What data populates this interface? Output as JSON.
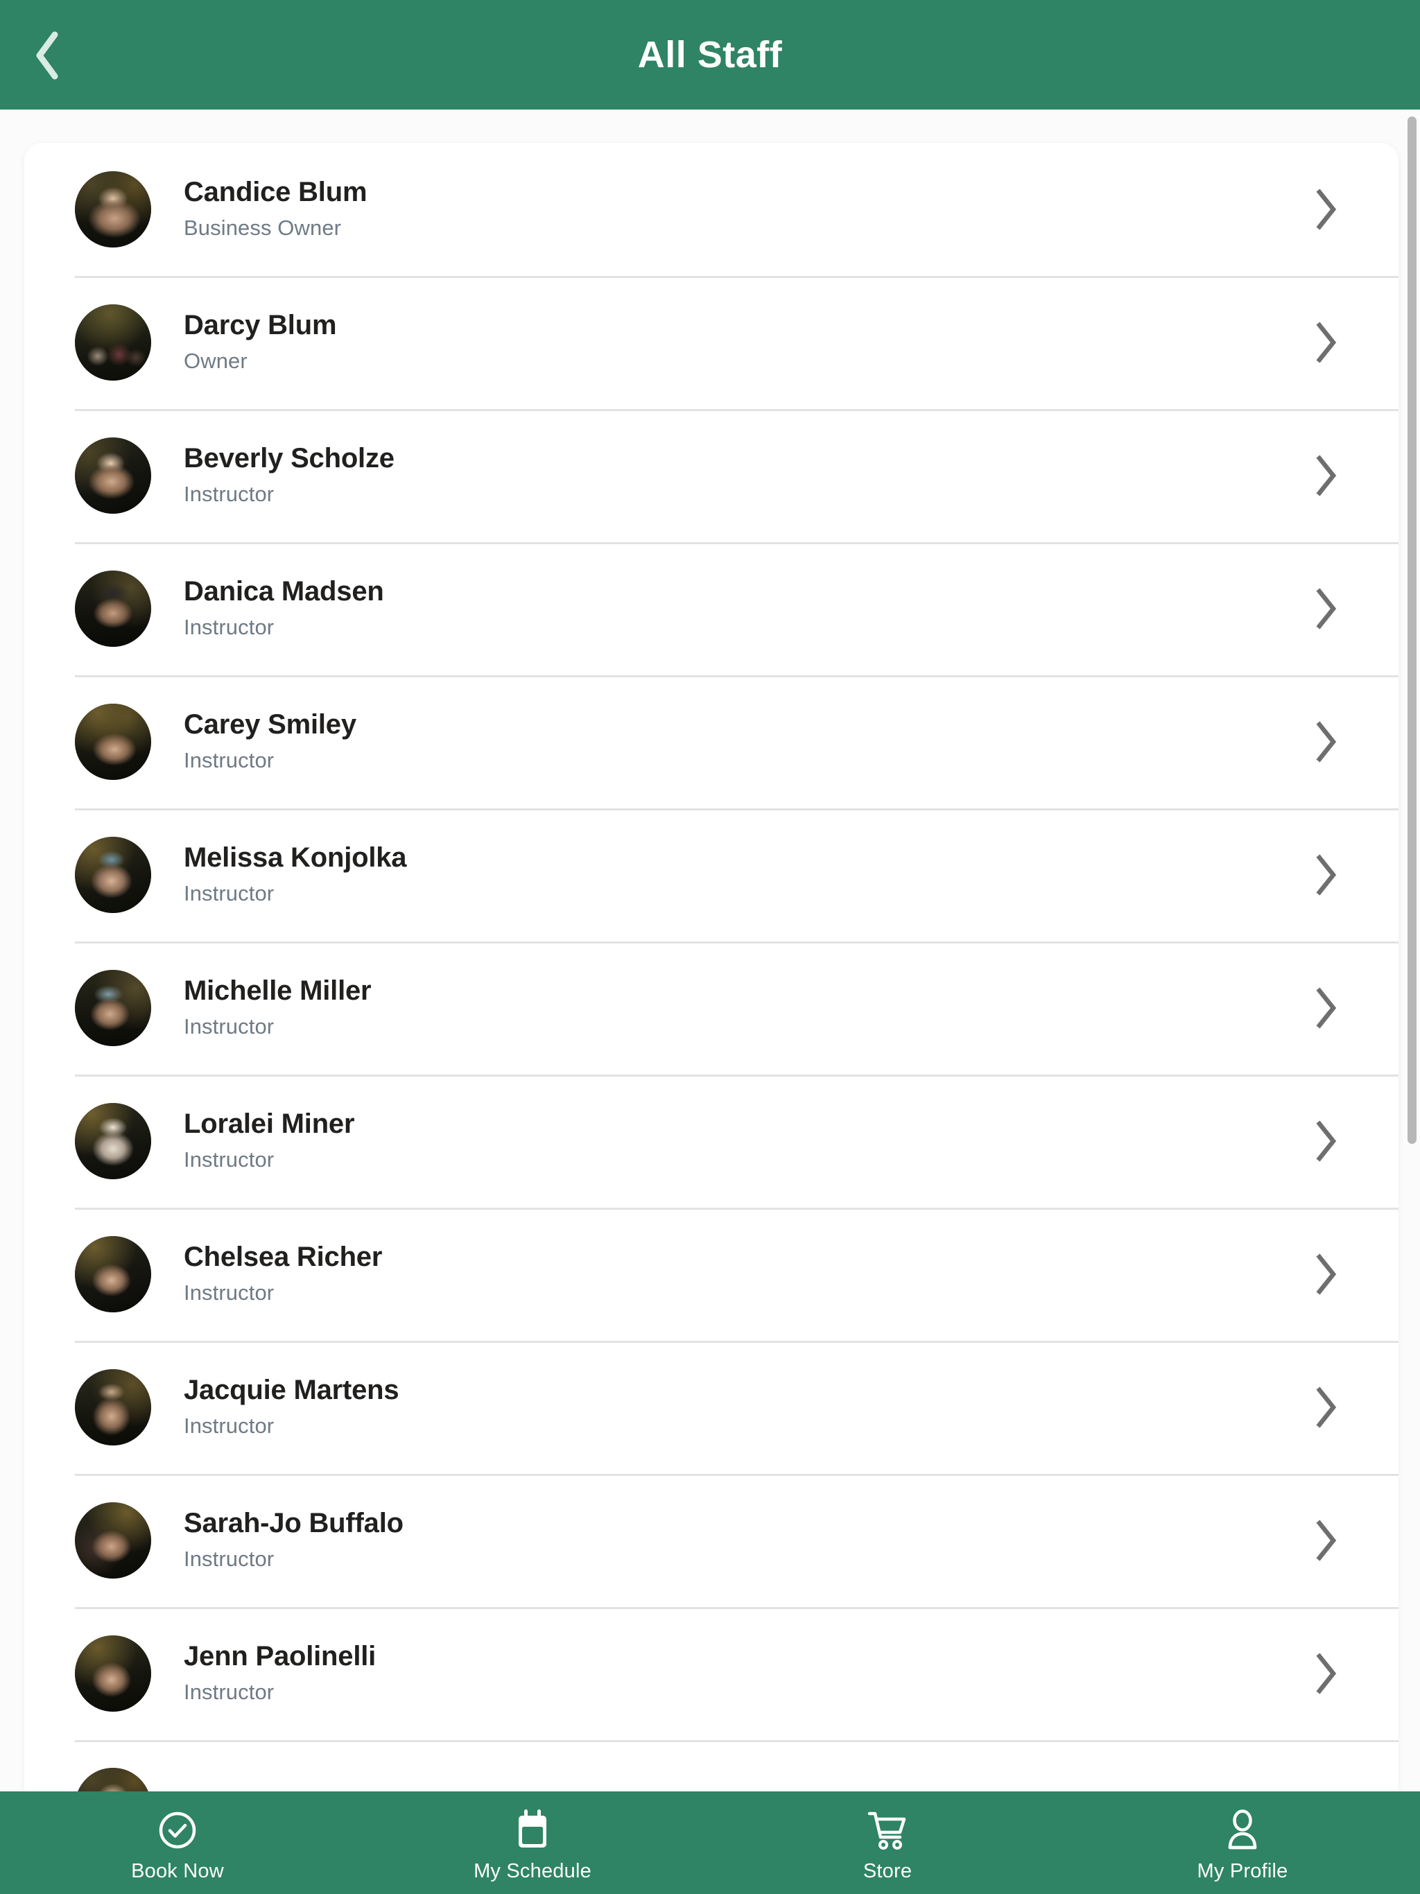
{
  "header": {
    "title": "All Staff",
    "back_icon": "chevron-left-icon",
    "background_color": "#2E8465",
    "title_color": "#FFFFFF"
  },
  "list": {
    "row_chevron_icon": "chevron-right-icon",
    "staff": [
      {
        "name": "Candice Blum",
        "role": "Business Owner",
        "avatar": "av-a"
      },
      {
        "name": "Darcy Blum",
        "role": "Owner",
        "avatar": "av-b"
      },
      {
        "name": "Beverly Scholze",
        "role": "Instructor",
        "avatar": "av-c"
      },
      {
        "name": "Danica Madsen",
        "role": "Instructor",
        "avatar": "av-d"
      },
      {
        "name": "Carey Smiley",
        "role": "Instructor",
        "avatar": "av-e"
      },
      {
        "name": "Melissa Konjolka",
        "role": "Instructor",
        "avatar": "av-f"
      },
      {
        "name": "Michelle Miller",
        "role": "Instructor",
        "avatar": "av-g"
      },
      {
        "name": "Loralei Miner",
        "role": "Instructor",
        "avatar": "av-h"
      },
      {
        "name": "Chelsea Richer",
        "role": "Instructor",
        "avatar": "av-i"
      },
      {
        "name": "Jacquie Martens",
        "role": "Instructor",
        "avatar": "av-j"
      },
      {
        "name": "Sarah-Jo Buffalo",
        "role": "Instructor",
        "avatar": "av-k"
      },
      {
        "name": "Jenn Paolinelli",
        "role": "Instructor",
        "avatar": "av-l"
      }
    ],
    "name_color": "#21201F",
    "role_color": "#6F7A85",
    "divider_color": "#E2E2E2"
  },
  "scrollbar": {
    "thumb_color": "#B7B7B7"
  },
  "bottom_nav": {
    "background_color": "#2E8465",
    "items": [
      {
        "label": "Book Now",
        "icon": "check-circle-icon"
      },
      {
        "label": "My Schedule",
        "icon": "calendar-icon"
      },
      {
        "label": "Store",
        "icon": "shopping-cart-icon"
      },
      {
        "label": "My Profile",
        "icon": "person-icon"
      }
    ]
  }
}
